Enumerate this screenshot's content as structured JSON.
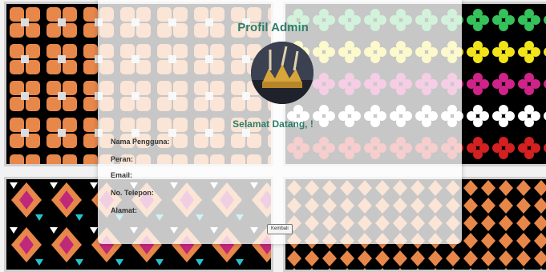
{
  "profile": {
    "title": "Profil Admin",
    "welcome": "Selamat Datang, !",
    "fields": {
      "username": "Nama Pengguna:",
      "role": "Peran:",
      "email": "Email:",
      "phone": "No. Telepon:",
      "address": "Alamat:"
    },
    "back_button": "Kembali"
  },
  "colors": {
    "accent": "#2e7d67",
    "pattern_orange": "#e8874a",
    "pattern_pink": "#c0287a"
  },
  "icons": {
    "avatar": "admin-avatar-image"
  }
}
